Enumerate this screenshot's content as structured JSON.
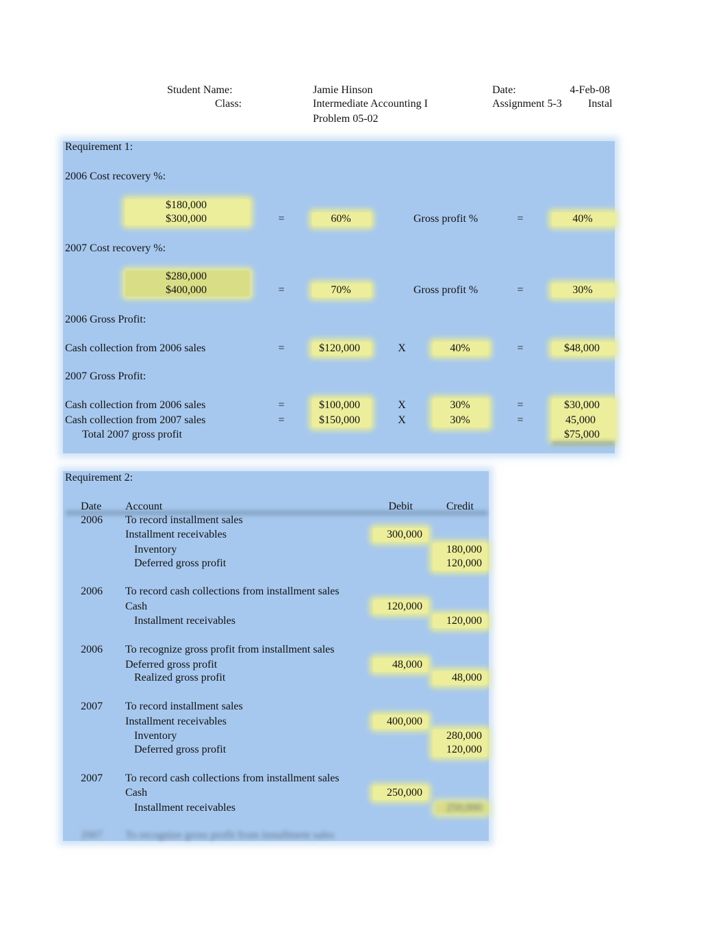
{
  "header": {
    "student_name_label": "Student Name:",
    "student_name": "Jamie Hinson",
    "date_label": "Date:",
    "date": "4-Feb-08",
    "class_label": "Class:",
    "class": "Intermediate Accounting I",
    "assignment": "Assignment 5-3",
    "assignment_topic": "Instal",
    "problem": "Problem 05-02"
  },
  "req1": {
    "title": "Requirement 1:",
    "cost_recovery_2006": {
      "label": "2006 Cost recovery %:",
      "numerator": "$180,000",
      "denominator": "$300,000",
      "eq": "=",
      "ratio": "60%",
      "gp_label": "Gross profit %",
      "eq2": "=",
      "gp": "40%"
    },
    "cost_recovery_2007": {
      "label": "2007 Cost recovery %:",
      "numerator": "$280,000",
      "denominator": "$400,000",
      "eq": "=",
      "ratio": "70%",
      "gp_label": "Gross profit %",
      "eq2": "=",
      "gp": "30%"
    },
    "gross_profit_2006": {
      "label": "2006 Gross Profit:",
      "rows": [
        {
          "desc": "Cash collection from 2006 sales",
          "eq": "=",
          "cash": "$120,000",
          "x": "X",
          "pct": "40%",
          "eq2": "=",
          "result": "$48,000"
        }
      ]
    },
    "gross_profit_2007": {
      "label": "2007 Gross Profit:",
      "rows": [
        {
          "desc": "Cash collection from 2006 sales",
          "eq": "=",
          "cash": "$100,000",
          "x": "X",
          "pct": "30%",
          "eq2": "=",
          "result": "$30,000"
        },
        {
          "desc": "Cash collection from 2007 sales",
          "eq": "=",
          "cash": "$150,000",
          "x": "X",
          "pct": "30%",
          "eq2": "=",
          "result": "45,000"
        }
      ],
      "total_label": "Total 2007 gross profit",
      "total": "$75,000"
    }
  },
  "req2": {
    "title": "Requirement 2:",
    "columns": {
      "date": "Date",
      "account": "Account",
      "debit": "Debit",
      "credit": "Credit"
    },
    "entries": [
      {
        "date": "2006",
        "desc": "To record installment sales",
        "lines": [
          {
            "account": "Installment receivables",
            "debit": "300,000",
            "credit": ""
          },
          {
            "account": "Inventory",
            "debit": "",
            "credit": "180,000"
          },
          {
            "account": "Deferred gross profit",
            "debit": "",
            "credit": "120,000"
          }
        ]
      },
      {
        "date": "2006",
        "desc": "To record cash collections from installment sales",
        "lines": [
          {
            "account": "Cash",
            "debit": "120,000",
            "credit": ""
          },
          {
            "account": "Installment receivables",
            "debit": "",
            "credit": "120,000"
          }
        ]
      },
      {
        "date": "2006",
        "desc": "To recognize gross profit from installment sales",
        "lines": [
          {
            "account": "Deferred gross profit",
            "debit": "48,000",
            "credit": ""
          },
          {
            "account": "Realized gross profit",
            "debit": "",
            "credit": "48,000"
          }
        ]
      },
      {
        "date": "2007",
        "desc": "To record installment sales",
        "lines": [
          {
            "account": "Installment receivables",
            "debit": "400,000",
            "credit": ""
          },
          {
            "account": "Inventory",
            "debit": "",
            "credit": "280,000"
          },
          {
            "account": "Deferred gross profit",
            "debit": "",
            "credit": "120,000"
          }
        ]
      },
      {
        "date": "2007",
        "desc": "To record cash collections from installment sales",
        "lines": [
          {
            "account": "Cash",
            "debit": "250,000",
            "credit": ""
          },
          {
            "account": "Installment receivables",
            "debit": "",
            "credit": "250,000"
          }
        ]
      },
      {
        "date": "2007",
        "desc": "To recognize gross profit from installment sales",
        "lines": []
      }
    ]
  }
}
